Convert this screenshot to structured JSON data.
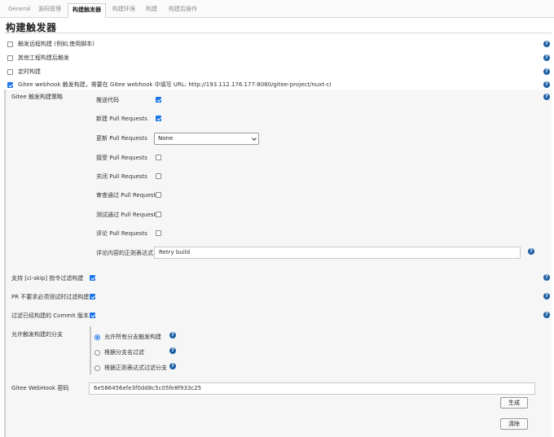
{
  "tabs": [
    "General",
    "源码管理",
    "构建触发器",
    "构建环境",
    "构建",
    "构建后操作"
  ],
  "section_title": "构建触发器",
  "triggers": [
    {
      "label": "触发远程构建 (例如,使用脚本)",
      "checked": false
    },
    {
      "label": "其他工程构建后触发",
      "checked": false
    },
    {
      "label": "定时构建",
      "checked": false
    },
    {
      "label": "Gitee webhook 触发构建，需要在 Gitee webhook 中填写 URL: http://193.112.176.177:8080/gitee-project/nuxt-ci",
      "checked": true
    }
  ],
  "strategy": {
    "label": "Gitee 触发构建策略",
    "push": "推送代码",
    "new_pr": "新建 Pull Requests",
    "update_pr": "更新 Pull Requests",
    "update_pr_value": "None",
    "accept_pr": "接受 Pull Requests",
    "close_pr": "关闭 Pull Requests",
    "approved_pr": "审查通过 Pull Requests",
    "tested_pr": "测试通过 Pull Requests",
    "comment_pr": "评论 Pull Requests",
    "comment_regex_label": "评论内容的正则表达式",
    "comment_regex_value": "Retry build"
  },
  "options": {
    "ci_skip": "支持 [ci-skip] 指令过滤构建",
    "pr_no_test": "PR 不要求必须测试时过滤构建",
    "filter_commit": "过滤已经构建的 Commit 版本"
  },
  "branches": {
    "label": "允许触发构建的分支",
    "all": "允许所有分支触发构建",
    "by_name": "根据分支名过滤",
    "by_regex": "根据正则表达式过滤分支"
  },
  "webhook": {
    "label": "Gitee WebHook 密码",
    "value": "6e586456efe3f0dd8c5c05fe8f933c25",
    "generate": "生成",
    "clear": "清除"
  },
  "help_glyph": "?",
  "colors": {
    "accent": "#1a73e8",
    "help": "#1d5fa3"
  }
}
